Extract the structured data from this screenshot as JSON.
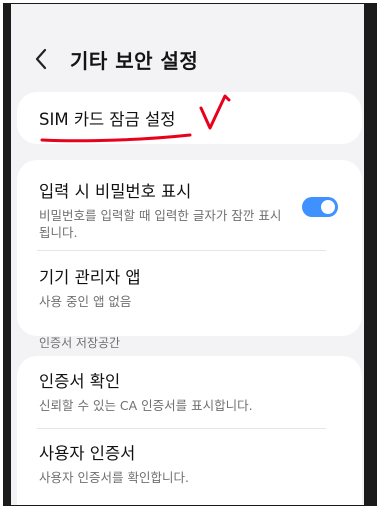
{
  "header": {
    "title": "기타 보안 설정"
  },
  "items": [
    {
      "title": "SIM 카드 잠금 설정"
    },
    {
      "title": "입력 시 비밀번호 표시",
      "subtitle": "비밀번호를 입력할 때 입력한 글자가 잠깐 표시됩니다.",
      "toggle_on": true
    },
    {
      "title": "기기 관리자 앱",
      "subtitle": "사용 중인 앱 없음"
    },
    {
      "title": "인증서 확인",
      "subtitle": "신뢰할 수 있는 CA 인증서를 표시합니다."
    },
    {
      "title": "사용자 인증서",
      "subtitle": "사용자 인증서를 확인합니다."
    }
  ],
  "section_header": "인증서 저장공간",
  "colors": {
    "toggle_on": "#3e91ff",
    "annotation_red": "#e8001c",
    "background": "#f3f3f5"
  }
}
